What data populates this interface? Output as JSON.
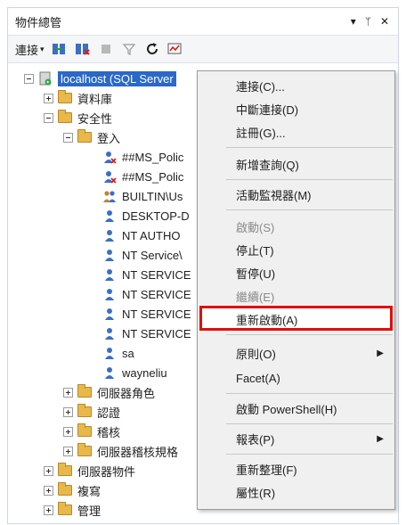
{
  "panel": {
    "title": "物件總管",
    "pin": "▾ ᛘ ✕"
  },
  "toolbar": {
    "connect_label": "連接"
  },
  "tree": {
    "server": "localhost (SQL Server",
    "databases": "資料庫",
    "security": "安全性",
    "logins": "登入",
    "login_items": [
      "##MS_Polic",
      "##MS_Polic",
      "BUILTIN\\Us",
      "DESKTOP-D",
      "NT AUTHO",
      "NT Service\\",
      "NT SERVICE",
      "NT SERVICE",
      "NT SERVICE",
      "NT SERVICE",
      "sa",
      "wayneliu"
    ],
    "server_roles": "伺服器角色",
    "credentials": "認證",
    "audits": "稽核",
    "audit_specs": "伺服器稽核規格",
    "server_objects": "伺服器物件",
    "replication": "複寫",
    "management": "管理"
  },
  "context_menu": {
    "connect": "連接(C)...",
    "disconnect": "中斷連接(D)",
    "register": "註冊(G)...",
    "new_query": "新增查詢(Q)",
    "activity_monitor": "活動監視器(M)",
    "start": "啟動(S)",
    "stop": "停止(T)",
    "pause": "暫停(U)",
    "resume": "繼續(E)",
    "restart": "重新啟動(A)",
    "policies": "原則(O)",
    "facets": "Facet(A)",
    "powershell": "啟動 PowerShell(H)",
    "reports": "報表(P)",
    "refresh": "重新整理(F)",
    "properties": "屬性(R)"
  }
}
